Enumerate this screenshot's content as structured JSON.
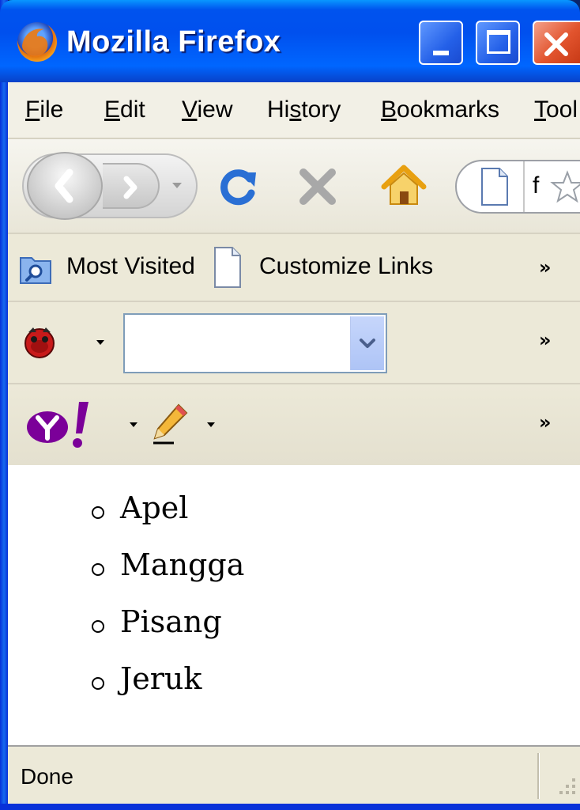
{
  "window": {
    "title": "Mozilla Firefox"
  },
  "menu": {
    "items": [
      {
        "label": "File",
        "accel": "F",
        "rest": "ile"
      },
      {
        "label": "Edit",
        "accel": "E",
        "rest": "dit"
      },
      {
        "label": "View",
        "accel": "V",
        "rest": "iew"
      },
      {
        "label": "History",
        "pre": "Hi",
        "accel": "s",
        "rest": "tory"
      },
      {
        "label": "Bookmarks",
        "accel": "B",
        "rest": "ookmarks"
      },
      {
        "label": "Tools",
        "accel": "T",
        "rest": "ool"
      }
    ]
  },
  "navigation": {
    "address_text": "f",
    "icons": [
      "back-icon",
      "forward-icon",
      "history-dropdown-icon",
      "reload-icon",
      "stop-icon",
      "home-icon",
      "page-icon",
      "bookmark-star-icon"
    ]
  },
  "bookmarks": {
    "items": [
      "Most Visited",
      "Customize Links"
    ],
    "overflow": "»"
  },
  "search_toolbar": {
    "value": "",
    "overflow": "»"
  },
  "yahoo_toolbar": {
    "overflow": "»"
  },
  "content": {
    "list": [
      "Apel",
      "Mangga",
      "Pisang",
      "Jeruk"
    ]
  },
  "status": {
    "text": "Done"
  },
  "colors": {
    "title_bar": "#0053ee",
    "chrome": "#ece9d8",
    "close_button": "#e2542e"
  }
}
